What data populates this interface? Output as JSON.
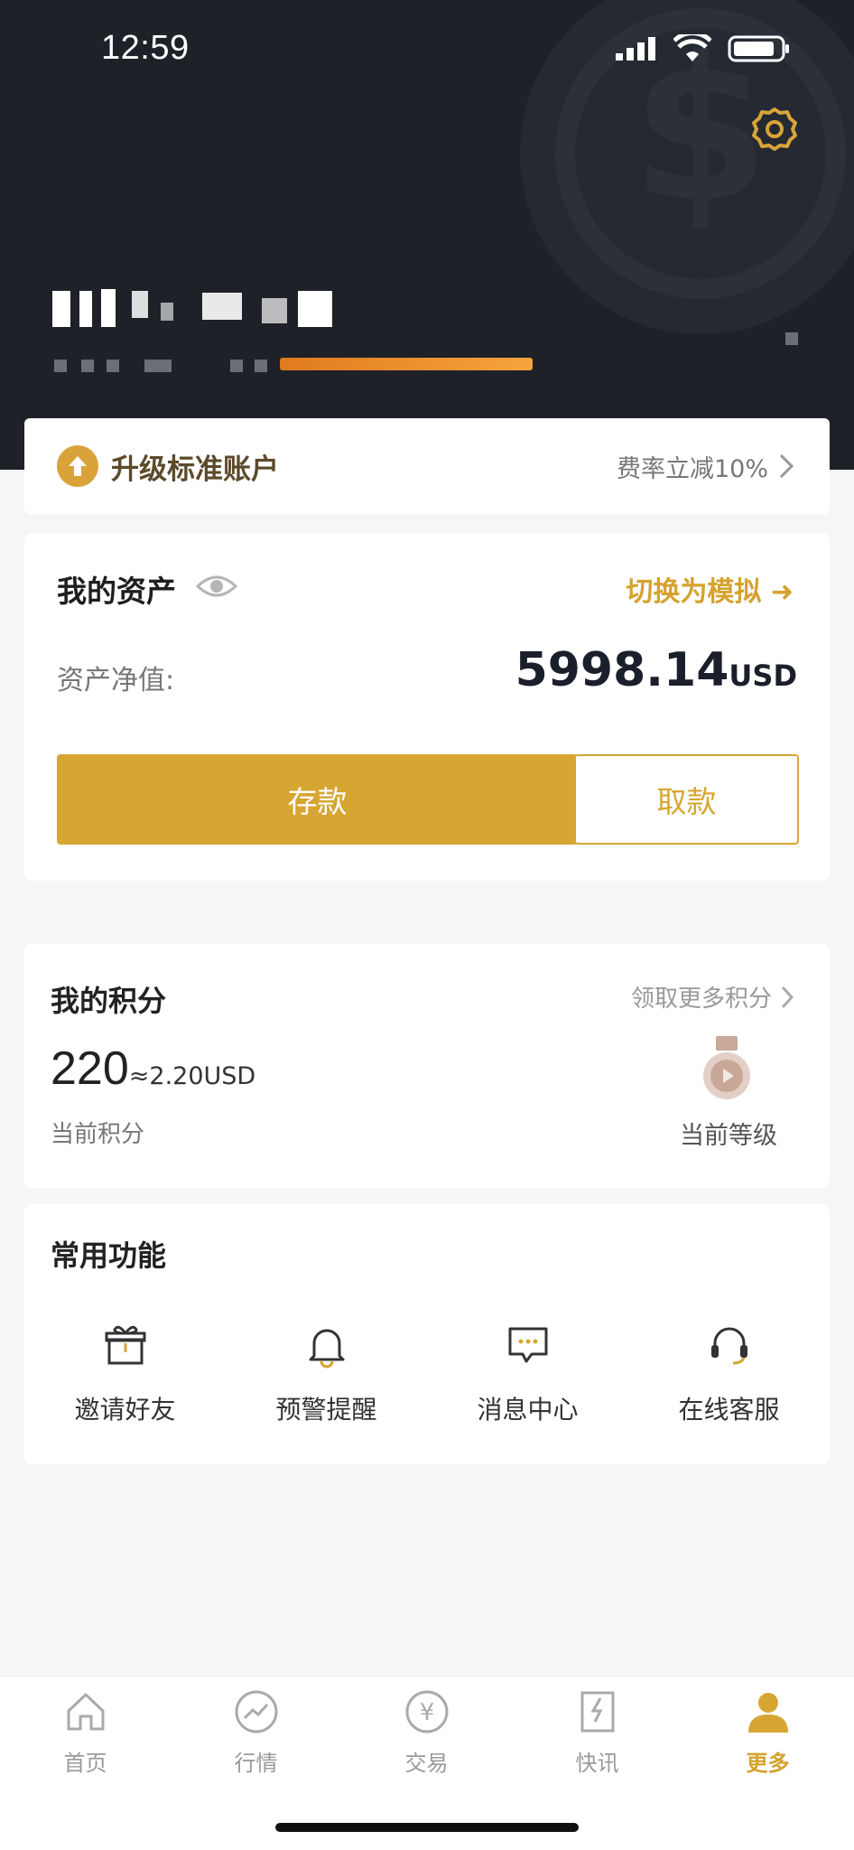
{
  "status_bar": {
    "time": "12:59"
  },
  "upgrade_banner": {
    "label": "升级标准账户",
    "promo": "费率立减10%"
  },
  "assets": {
    "title": "我的资产",
    "switch_label": "切换为模拟",
    "net_value_label": "资产净值:",
    "net_value": "5998.14",
    "currency": "USD",
    "deposit_label": "存款",
    "withdraw_label": "取款"
  },
  "points": {
    "title": "我的积分",
    "more_label": "领取更多积分",
    "value": "220",
    "approx": "≈2.20USD",
    "current_points_label": "当前积分",
    "current_level_label": "当前等级"
  },
  "functions": {
    "title": "常用功能",
    "items": [
      {
        "label": "邀请好友",
        "icon": "gift-icon"
      },
      {
        "label": "预警提醒",
        "icon": "bell-icon"
      },
      {
        "label": "消息中心",
        "icon": "message-icon"
      },
      {
        "label": "在线客服",
        "icon": "headset-icon"
      }
    ]
  },
  "tabbar": {
    "items": [
      {
        "label": "首页",
        "icon": "home-icon"
      },
      {
        "label": "行情",
        "icon": "chart-icon"
      },
      {
        "label": "交易",
        "icon": "yen-icon"
      },
      {
        "label": "快讯",
        "icon": "news-icon"
      },
      {
        "label": "更多",
        "icon": "user-icon"
      }
    ],
    "active_index": 4
  },
  "colors": {
    "accent": "#d7a632",
    "header_bg": "#1e2128"
  }
}
